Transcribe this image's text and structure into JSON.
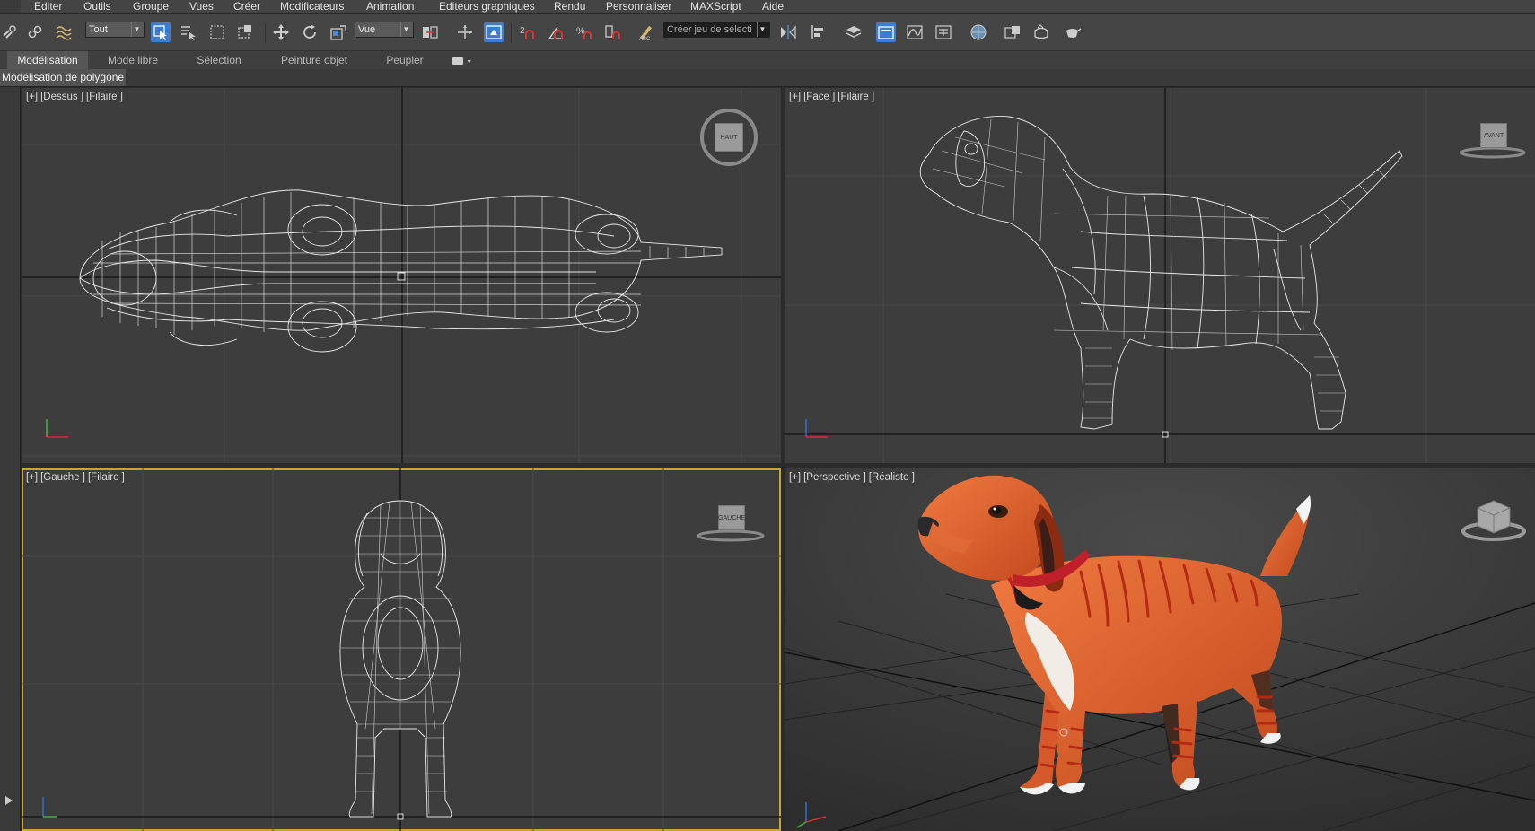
{
  "menu": {
    "items": [
      "Editer",
      "Outils",
      "Groupe",
      "Vues",
      "Créer",
      "Modificateurs",
      "Animation",
      "Editeurs graphiques",
      "Rendu",
      "Personnaliser",
      "MAXScript",
      "Aide"
    ]
  },
  "toolbar": {
    "filter_select": "Tout",
    "ref_coord_select": "Vue",
    "named_selection_placeholder": "Créer jeu de sélecti"
  },
  "ribbon": {
    "tabs": [
      "Modélisation",
      "Mode libre",
      "Sélection",
      "Peinture objet",
      "Peupler"
    ],
    "active_tab": "Modélisation",
    "sub_label": "Modélisation de polygone"
  },
  "viewports": {
    "top": {
      "name": "[+]",
      "view": "[Dessus ]",
      "shading": "[Filaire ]",
      "cube_label": "HAUT"
    },
    "front": {
      "name": "[+]",
      "view": "[Face ]",
      "shading": "[Filaire ]",
      "cube_label": "AVANT"
    },
    "left": {
      "name": "[+]",
      "view": "[Gauche ]",
      "shading": "[Filaire ]",
      "cube_label": "GAUCHE"
    },
    "perspective": {
      "name": "[+]",
      "view": "[Perspective ]",
      "shading": "[Réaliste ]"
    }
  },
  "colors": {
    "viewport_bg": "#3d3d3d",
    "active_border": "#c5a63b",
    "toolbar_active": "#3d7dd0",
    "wire": "#e8e8e8",
    "dog_orange": "#e0622e",
    "collar": "#c0202a"
  }
}
